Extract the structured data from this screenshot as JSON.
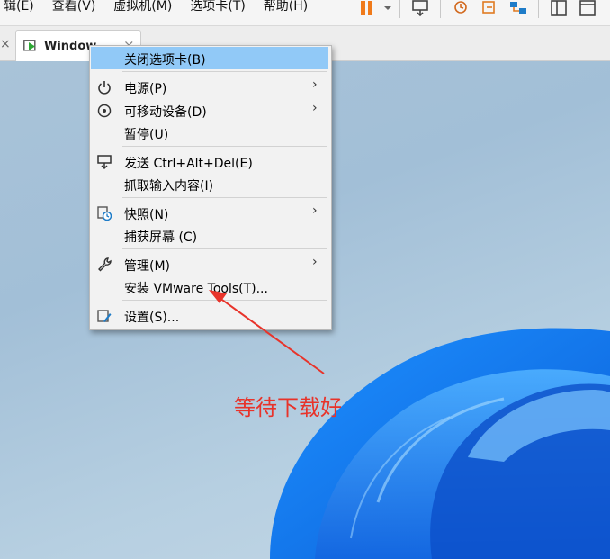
{
  "menubar": {
    "items": [
      "辑(E)",
      "查看(V)",
      "虚拟机(M)",
      "选项卡(T)",
      "帮助(H)"
    ]
  },
  "tabs": {
    "active_label": "Window..."
  },
  "context_menu": {
    "items": [
      {
        "label": "关闭选项卡(B)",
        "highlighted": true
      },
      {
        "label": "电源(P)",
        "submenu": true,
        "icon": "power-icon"
      },
      {
        "label": "可移动设备(D)",
        "submenu": true,
        "icon": "removable-device-icon"
      },
      {
        "label": "暂停(U)"
      },
      {
        "label": "发送 Ctrl+Alt+Del(E)",
        "icon": "send-keys-icon"
      },
      {
        "label": "抓取输入内容(I)"
      },
      {
        "label": "快照(N)",
        "submenu": true,
        "icon": "snapshot-icon"
      },
      {
        "label": "捕获屏幕 (C)"
      },
      {
        "label": "管理(M)",
        "submenu": true,
        "icon": "wrench-icon"
      },
      {
        "label": "安装 VMware Tools(T)..."
      },
      {
        "label": "设置(S)...",
        "icon": "settings-icon"
      }
    ]
  },
  "annotation": {
    "text": "等待下载好",
    "color": "#e8332a"
  },
  "colors": {
    "highlight": "#91c9f7",
    "accent_orange": "#f07a1a"
  }
}
